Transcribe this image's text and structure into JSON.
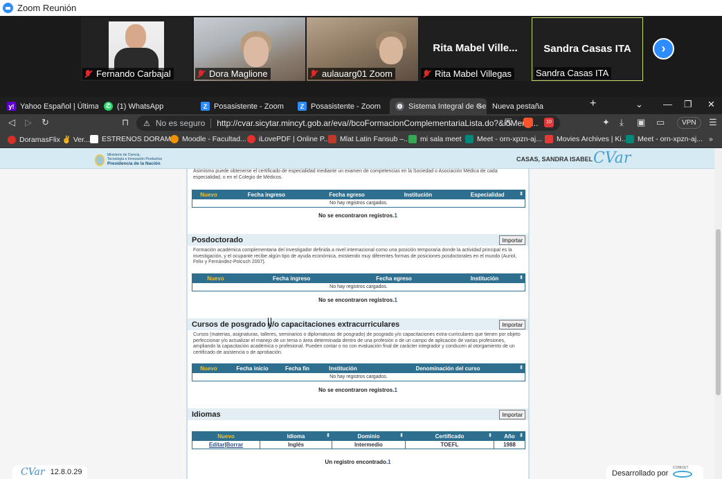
{
  "zoom": {
    "title": "Zoom Reunión",
    "participants": [
      {
        "name": "Fernando Carbajal",
        "muted": true
      },
      {
        "name": "Dora Maglione",
        "muted": true
      },
      {
        "name": "aulauarg01 Zoom",
        "muted": true
      },
      {
        "name": "Rita Mabel Villegas",
        "display_name": "Rita Mabel Ville...",
        "muted": true
      },
      {
        "name": "Sandra Casas ITA",
        "display_name": "Sandra Casas ITA",
        "muted": false,
        "active": true
      }
    ],
    "accent": "#2d8cff"
  },
  "browser": {
    "tabs": [
      {
        "label": "Yahoo Español | Últimas no",
        "icon": "yahoo-icon",
        "color": "#6001d2",
        "glyph": "y!"
      },
      {
        "label": "(1) WhatsApp",
        "icon": "whatsapp-icon",
        "color": "#25d366",
        "glyph": "✆"
      },
      {
        "label": "Posasistente - Zoom",
        "icon": "zoom-icon",
        "color": "#2d8cff",
        "glyph": "Z"
      },
      {
        "label": "Posasistente - Zoom",
        "icon": "zoom-icon",
        "color": "#2d8cff",
        "glyph": "Z"
      },
      {
        "label": "Sistema Integral de Ge",
        "icon": "globe-icon",
        "color": "#5f6368",
        "glyph": "◍",
        "active": true
      },
      {
        "label": "Nueva pestaña",
        "icon": "",
        "color": "",
        "glyph": ""
      }
    ],
    "security_label": "No es seguro",
    "url": "http://cvar.sicytar.mincyt.gob.ar/eva//bcoFormacionComplementariaLista.do?&idMenu...",
    "brave_badge": "10",
    "vpn_label": "VPN",
    "bookmarks": [
      {
        "label": "DoramasFlix ✌ Ver...",
        "color": "#d93025"
      },
      {
        "label": "ESTRENOS DORAM...",
        "color": "#ffffff"
      },
      {
        "label": "Moodle - Facultad...",
        "color": "#f29100"
      },
      {
        "label": "iLovePDF | Online P...",
        "color": "#e5322d"
      },
      {
        "label": "Mlat Latin Fansub –...",
        "color": "#c0392b"
      },
      {
        "label": "mi sala meet",
        "color": "#34a853"
      },
      {
        "label": "Meet - orn-xpzn-aj...",
        "color": "#00897b"
      },
      {
        "label": "Movies Archives | Ki...",
        "color": "#e53935"
      },
      {
        "label": "Meet - orn-xpzn-aj...",
        "color": "#00897b"
      }
    ]
  },
  "site": {
    "gov_line1": "Ministerio de Ciencia,",
    "gov_line2": "Tecnología e Innovación Productiva",
    "gov_line3": "Presidencia de la Nación",
    "user": "CASAS, SANDRA ISABEL",
    "logo": "CVar"
  },
  "page": {
    "intro_text": "Asimismo puede obtenerse el certificado de especialidad mediante un examen de competencias en la Sociedad o Asociación Médica de cada especialidad, o en el Colegio de Médicos.",
    "import_label": "Importar",
    "specialty_table": {
      "headers": [
        "Nuevo",
        "Fecha ingreso",
        "Fecha egreso",
        "Institución",
        "Especialidad"
      ],
      "empty_text": "No hay registros cargados.",
      "result": "No se encontraron registros.",
      "result_num": "1"
    },
    "posdoc": {
      "title": "Posdoctorado",
      "description": "Formación académica complementaria del investigador definida a nivel internacional como una posición temporaria donde la actividad principal es la investigación, y el ocupante recibe algún tipo de ayuda económica, existiendo muy diferentes formas de posiciones posdoctorales en el mundo (Auriol, Felix y Fernández-Polcuch 2007).",
      "headers": [
        "Nuevo",
        "Fecha ingreso",
        "Fecha egreso",
        "Institución"
      ],
      "empty_text": "No hay registros cargados.",
      "result": "No se encontraron registros.",
      "result_num": "1"
    },
    "courses": {
      "title": "Cursos de posgrado y/o capacitaciones extracurriculares",
      "description": "Cursos (materias, asignaturas, talleres, seminarios o diplomaturas de posgrado) de posgrado y/o capacitaciones extra-curriculares que tienen por objeto perfeccionar y/o actualizar el manejo de un tema o área determinada dentro de una profesión o de un campo de aplicación de varias profesiones, ampliando la capacitación académica o profesional. Pueden contar o no con evaluación final de carácter integrador y conducen al otorgamiento de un certificado de asistencia o de aprobación.",
      "headers": [
        "Nuevo",
        "Fecha inicio",
        "Fecha fin",
        "Institución",
        "Denominación del curso"
      ],
      "empty_text": "No hay registros cargados.",
      "result": "No se encontraron registros.",
      "result_num": "1"
    },
    "languages": {
      "title": "Idiomas",
      "headers": [
        "Nuevo",
        "Idioma",
        "Dominio",
        "Certificado",
        "Año"
      ],
      "row": {
        "edit": "Editar",
        "sep": "|",
        "delete": "Borrar",
        "idioma": "Inglés",
        "dominio": "Intermedio",
        "certificado": "TOEFL",
        "anio": "1988"
      },
      "result": "Un registro encontrado.",
      "result_num": "1"
    }
  },
  "footer": {
    "logo": "CVar",
    "version": "12.8.0.29",
    "developed_by": "Desarrollado por",
    "conicet": "CONICET"
  }
}
